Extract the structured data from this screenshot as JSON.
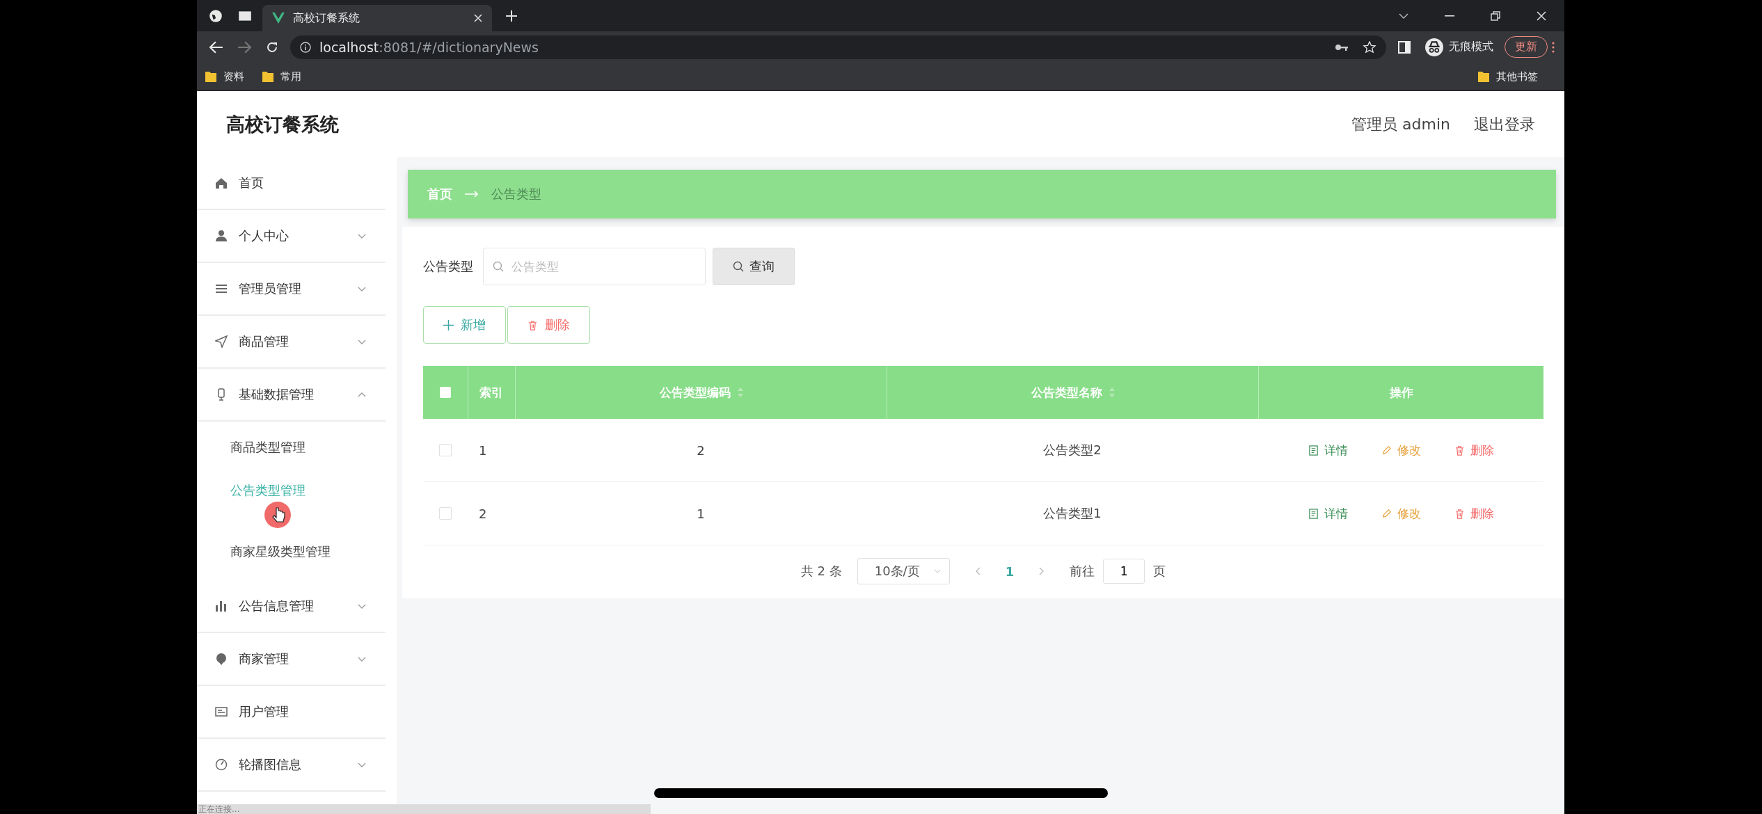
{
  "browser": {
    "tabs": [
      {
        "title": "高校订餐系统",
        "selected": true
      }
    ],
    "url_host": "localhost",
    "url_path": ":8081/#/dictionaryNews",
    "incognito_label": "无痕模式",
    "update_button": "更新",
    "bookmarks": [
      "资料",
      "常用"
    ],
    "other_bookmarks": "其他书签"
  },
  "app": {
    "title": "高校订餐系统",
    "user": "管理员 admin",
    "logout": "退出登录"
  },
  "sidebar": {
    "items": [
      {
        "label": "首页"
      },
      {
        "label": "个人中心",
        "expanded": false
      },
      {
        "label": "管理员管理",
        "expanded": false
      },
      {
        "label": "商品管理",
        "expanded": false
      },
      {
        "label": "基础数据管理",
        "expanded": true,
        "children": [
          {
            "label": "商品类型管理",
            "selected": false
          },
          {
            "label": "公告类型管理",
            "selected": true
          },
          {
            "label": "商家星级类型管理",
            "selected": false
          }
        ]
      },
      {
        "label": "公告信息管理",
        "expanded": false
      },
      {
        "label": "商家管理",
        "expanded": false
      },
      {
        "label": "用户管理"
      },
      {
        "label": "轮播图信息",
        "expanded": false
      }
    ]
  },
  "breadcrumb": [
    "首页",
    "公告类型"
  ],
  "search": {
    "label": "公告类型",
    "placeholder": "公告类型",
    "button": "查询"
  },
  "actions": [
    {
      "label": "新增",
      "kind": "add"
    },
    {
      "label": "删除",
      "kind": "delete"
    }
  ],
  "table": {
    "columns": [
      {
        "label": "索引",
        "sortable": false
      },
      {
        "label": "公告类型编码",
        "sortable": true
      },
      {
        "label": "公告类型名称",
        "sortable": true
      },
      {
        "label": "操作",
        "sortable": false
      }
    ],
    "all_checked": false,
    "rows": [
      {
        "checked": false,
        "cells": [
          "1",
          "2",
          "公告类型2"
        ],
        "actions": [
          {
            "label": "详情",
            "kind": "detail"
          },
          {
            "label": "修改",
            "kind": "edit"
          },
          {
            "label": "删除",
            "kind": "delete"
          }
        ]
      },
      {
        "checked": false,
        "cells": [
          "2",
          "1",
          "公告类型1"
        ],
        "actions": [
          {
            "label": "详情",
            "kind": "detail"
          },
          {
            "label": "修改",
            "kind": "edit"
          },
          {
            "label": "删除",
            "kind": "delete"
          }
        ]
      }
    ]
  },
  "pagination": {
    "total": "共 2 条",
    "page_size": "10条/页",
    "pages": [
      {
        "label": "1",
        "selected": true
      }
    ],
    "goto_label": "前往",
    "goto_value": "1",
    "page_unit": "页"
  },
  "status_bar": "正在连接..."
}
